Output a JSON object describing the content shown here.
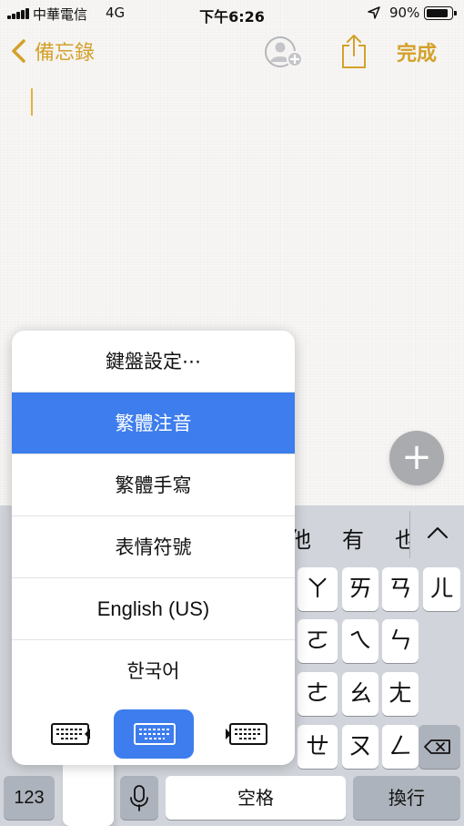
{
  "status_bar": {
    "carrier": "中華電信",
    "network": "4G",
    "time": "下午6:26",
    "battery_percent": "90%",
    "battery_level": 0.9,
    "icons": [
      "signal-icon",
      "location-arrow-icon",
      "battery-icon"
    ]
  },
  "nav": {
    "back_label": "備忘錄",
    "done_label": "完成",
    "icons": [
      "chevron-left-icon",
      "add-person-icon",
      "share-icon"
    ]
  },
  "fab": {
    "label": "+"
  },
  "keyboard": {
    "candidates": [
      "他",
      "有",
      "也"
    ],
    "rows": [
      [
        "ㄚ",
        "ㄞ",
        "ㄢ",
        "ㄦ"
      ],
      [
        "ㄛ",
        "ㄟ",
        "ㄣ"
      ],
      [
        "ㄜ",
        "ㄠ",
        "ㄤ"
      ],
      [
        "ㄝ",
        "ㄡ",
        "ㄥ"
      ]
    ],
    "key_123": "123",
    "space": "空格",
    "return": "換行",
    "icons": [
      "chevron-up-icon",
      "microphone-icon",
      "delete-icon"
    ]
  },
  "switcher": {
    "items": [
      {
        "label": "鍵盤設定⋯",
        "selected": false
      },
      {
        "label": "繁體注音",
        "selected": true
      },
      {
        "label": "繁體手寫",
        "selected": false
      },
      {
        "label": "表情符號",
        "selected": false
      },
      {
        "label": "English (US)",
        "selected": false
      },
      {
        "label": "한국어",
        "selected": false
      }
    ],
    "layouts": [
      "keyboard-left-icon",
      "keyboard-full-icon",
      "keyboard-right-icon"
    ],
    "selected_layout": "keyboard-full-icon"
  },
  "colors": {
    "accent": "#d4a12b",
    "selection": "#3d7ded",
    "keyboard_bg": "#d1d4da",
    "key_bg": "#ffffff",
    "dark_key_bg": "#adb3bc"
  }
}
